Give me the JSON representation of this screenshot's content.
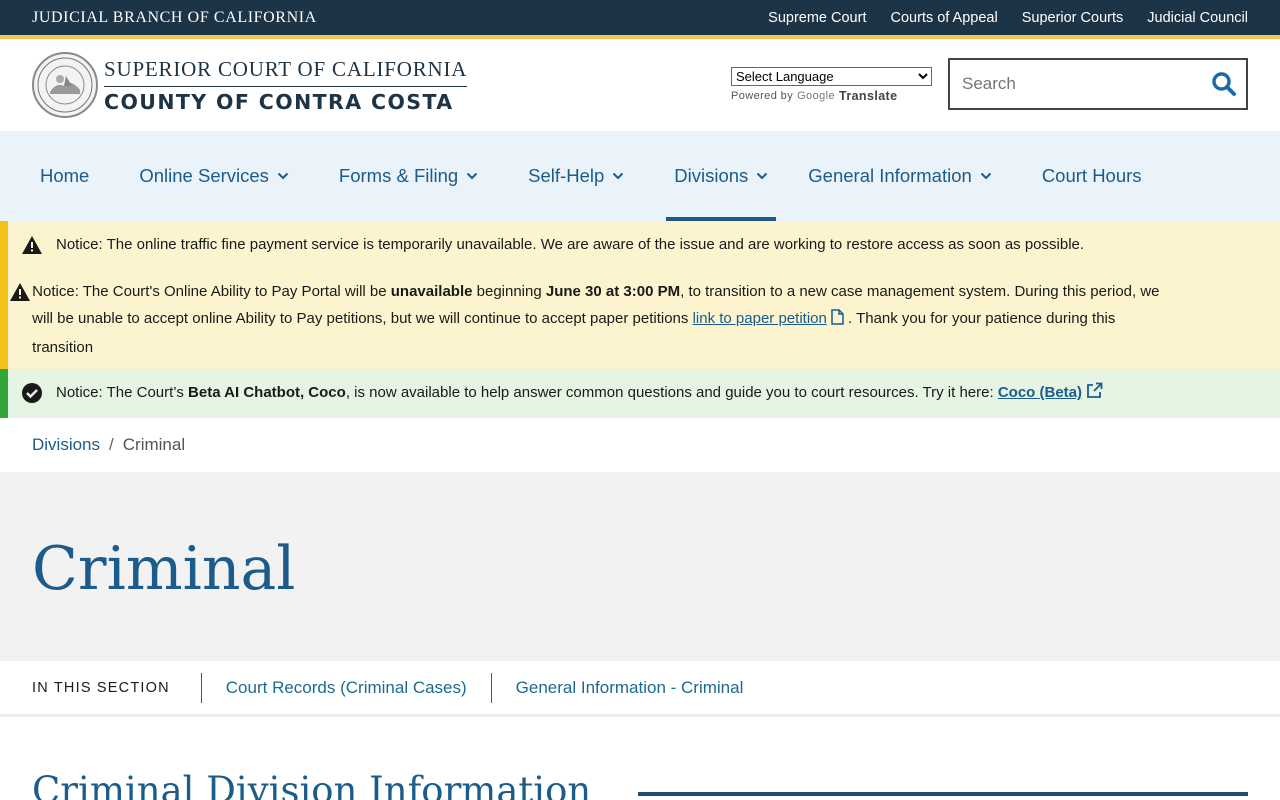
{
  "topbar": {
    "brand": "JUDICIAL BRANCH OF CALIFORNIA",
    "links": [
      "Supreme Court",
      "Courts of Appeal",
      "Superior Courts",
      "Judicial Council"
    ]
  },
  "header": {
    "court_line1": "SUPERIOR COURT OF CALIFORNIA",
    "court_line2": "COUNTY OF CONTRA COSTA",
    "language_select": "Select Language",
    "powered_by": "Powered by",
    "google": "Google",
    "translate": "Translate",
    "search_placeholder": "Search"
  },
  "mainnav": [
    {
      "label": "Home",
      "dropdown": false
    },
    {
      "label": "Online Services",
      "dropdown": true
    },
    {
      "label": "Forms & Filing",
      "dropdown": true
    },
    {
      "label": "Self-Help",
      "dropdown": true
    },
    {
      "label": "Divisions",
      "dropdown": true,
      "active": true
    },
    {
      "label": "General Information",
      "dropdown": true
    },
    {
      "label": "Court Hours",
      "dropdown": false
    }
  ],
  "notices": {
    "n1": {
      "prefix": "Notice: ",
      "text": "The online traffic fine payment service is temporarily unavailable. We are aware of the issue and are working to restore access as soon as possible."
    },
    "n2": {
      "prefix": "Notice: ",
      "t1": "The Court's Online Ability to Pay Portal will be ",
      "b1": "unavailable",
      "t2": " beginning ",
      "b2": "June 30 at 3:00 PM",
      "t3": ", to transition to a new case management system. During this period, we will be unable to accept online Ability to Pay petitions, but we will continue to accept paper petitions ",
      "link": "link to paper petition",
      "t4": " . Thank you for your patience during this transition"
    },
    "n3": {
      "prefix": "Notice: ",
      "t1": "The Court’s ",
      "b1": "Beta AI Chatbot, Coco",
      "t2": ", is now available to help answer common questions and guide you to court resources. Try it here: ",
      "link": "Coco (Beta)"
    }
  },
  "breadcrumb": {
    "parent": "Divisions",
    "separator": "/",
    "current": "Criminal"
  },
  "hero": {
    "title": "Criminal"
  },
  "section": {
    "label": "IN THIS SECTION",
    "links": [
      "Court Records (Criminal Cases)",
      "General Information - Criminal"
    ]
  },
  "content": {
    "heading": "Criminal Division Information"
  },
  "colors": {
    "topbar": "#1d3346",
    "gold": "#f4c64f",
    "link": "#1b5c8a",
    "nav_bg": "#eaf2fa",
    "warn_bg": "#fbf4cf",
    "ok_bg": "#e6f4e4"
  }
}
